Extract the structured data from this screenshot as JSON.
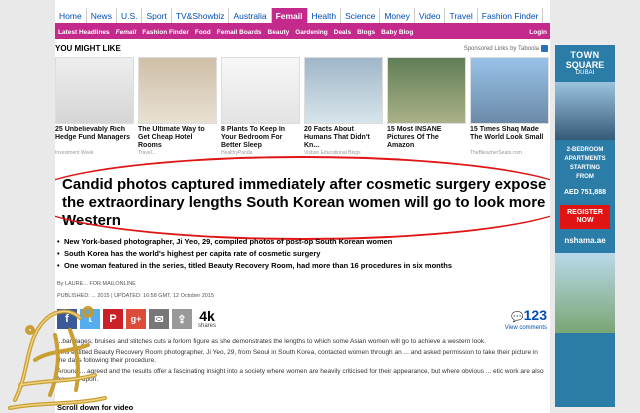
{
  "channel_nav": [
    {
      "label": "Home"
    },
    {
      "label": "News"
    },
    {
      "label": "U.S."
    },
    {
      "label": "Sport"
    },
    {
      "label": "TV&Showbiz"
    },
    {
      "label": "Australia"
    },
    {
      "label": "Femail",
      "active": true
    },
    {
      "label": "Health"
    },
    {
      "label": "Science"
    },
    {
      "label": "Money"
    },
    {
      "label": "Video"
    },
    {
      "label": "Travel"
    },
    {
      "label": "Fashion Finder"
    }
  ],
  "sub_nav": {
    "items": [
      "Latest Headlines",
      "Femail",
      "Fashion Finder",
      "Food",
      "Femail Boards",
      "Beauty",
      "Gardening",
      "Deals",
      "Blogs",
      "Baby Blog"
    ],
    "login": "Login"
  },
  "you_might_like": {
    "title": "YOU MIGHT LIKE",
    "sponsored": "Sponsored Links by Taboola",
    "cards": [
      {
        "title": "25 Unbelievably Rich Hedge Fund Managers",
        "source": "Investment Week"
      },
      {
        "title": "The Ultimate Way to Get Cheap Hotel Rooms",
        "source": "Travel..."
      },
      {
        "title": "8 Plants To Keep In Your Bedroom For Better Sleep",
        "source": "HealthyPanda"
      },
      {
        "title": "20 Facts About Humans That Didn't Kn...",
        "source": "Visboo Educational Blogs"
      },
      {
        "title": "15 Most INSANE Pictures Of The Amazon",
        "source": "..."
      },
      {
        "title": "15 Times Shaq Made The World Look Small",
        "source": "TheBleacherSeats.com"
      }
    ]
  },
  "article": {
    "headline": "Candid photos captured immediately after cosmetic surgery expose the extraordinary lengths South Korean women will go to look more Western",
    "bullets": [
      "New York-based photographer, Ji Yeo, 29, compiled photos of post-op South Korean women",
      "South Korea has the world's highest per capita rate of cosmetic surgery",
      "One woman featured in the series, titled Beauty Recovery Room, had more than 16 procedures in six months"
    ],
    "byline": "By LAURE... FOR MAILONLINE",
    "dates": "PUBLISHED: ... 2015 | UPDATED: 16:58 GMT, 12 October 2015",
    "shares_count": "4k",
    "shares_label": "shares",
    "comments_count": "123",
    "comments_label": "View comments",
    "paragraphs": [
      "...bandages, bruises and stitches cuts a forlorn figure as she demonstrates the lengths to which some Asian women will go to achieve a western look.",
      "...hs entitled Beauty Recovery Room photographer, Ji Yeo, 29, from Seoul in South Korea, contacted women through an ... and asked permission to take their picture in the days following their procedure.",
      "Around ... agreed and the results offer a fascinating insight into a society where women are heavily criticised for their appearance, but where obvious ... etic work are also frowned upon."
    ],
    "scroll_label": "Scroll down for video"
  },
  "ad": {
    "brand_line1": "TOWN",
    "brand_line2": "SQUARE",
    "brand_line3": "DUBAI",
    "lines": [
      "2-BEDROOM",
      "APARTMENTS",
      "STARTING",
      "FROM"
    ],
    "price": "AED 751,888",
    "button": "REGISTER NOW",
    "company": "nshama.ae"
  },
  "colors": {
    "femail_pink": "#c4298c",
    "link_blue": "#004db3",
    "highlight_red": "#e11414",
    "ad_blue": "#2c7ca8"
  }
}
